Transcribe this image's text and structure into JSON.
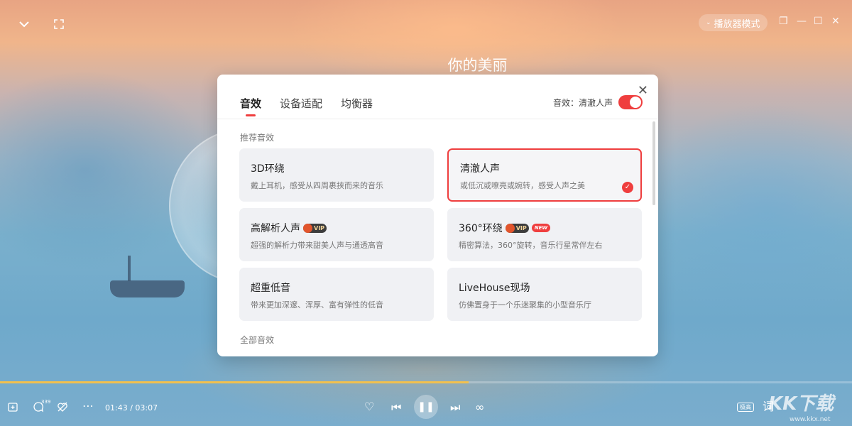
{
  "player": {
    "song_title": "你的美丽",
    "mode_label": "播放器模式",
    "current_time": "01:43",
    "total_time": "03:07",
    "comment_count": "339",
    "quality_tag": "极高",
    "lyrics_label": "词",
    "progress": 0.55
  },
  "dialog": {
    "tabs": [
      "音效",
      "设备适配",
      "均衡器"
    ],
    "effect_status_label": "音效：清澈人声",
    "toggle_on": true,
    "section_recommended": "推荐音效",
    "section_all": "全部音效",
    "cards": [
      {
        "title": "3D环绕",
        "desc": "戴上耳机，感受从四周裹挟而来的音乐",
        "vip": false,
        "new": false,
        "selected": false
      },
      {
        "title": "清澈人声",
        "desc": "或低沉或嘹亮或婉转，感受人声之美",
        "vip": false,
        "new": false,
        "selected": true
      },
      {
        "title": "高解析人声",
        "desc": "超强的解析力带来甜美人声与通透高音",
        "vip": true,
        "new": false,
        "selected": false
      },
      {
        "title": "360°环绕",
        "desc": "精密算法，360°旋转，音乐行星常伴左右",
        "vip": true,
        "new": true,
        "selected": false
      },
      {
        "title": "超重低音",
        "desc": "带来更加深邃、浑厚、富有弹性的低音",
        "vip": false,
        "new": false,
        "selected": false
      },
      {
        "title": "LiveHouse现场",
        "desc": "仿佛置身于一个乐迷聚集的小型音乐厅",
        "vip": false,
        "new": false,
        "selected": false
      }
    ],
    "vip_label": "VIP",
    "new_label": "NEW"
  },
  "watermark": {
    "logo_text": "KK下载",
    "url": "www.kkx.net"
  },
  "colors": {
    "accent": "#ef3e3e",
    "progress": "#f2c14e"
  }
}
